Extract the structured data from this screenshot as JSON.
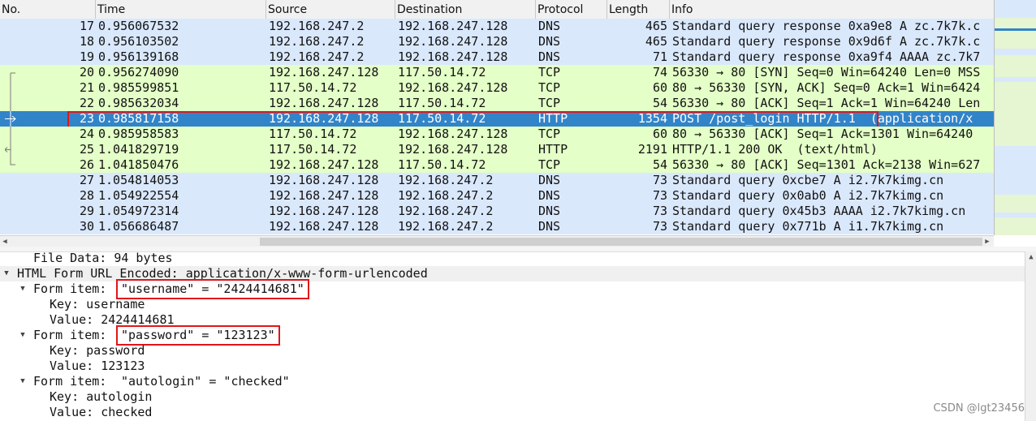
{
  "columns": [
    "No.",
    "Time",
    "Source",
    "Destination",
    "Protocol",
    "Length",
    "Info"
  ],
  "packets": [
    {
      "no": "17",
      "time": "0.956067532",
      "src": "192.168.247.2",
      "dst": "192.168.247.128",
      "proto": "DNS",
      "len": "465",
      "info": "Standard query response 0xa9e8 A zc.7k7k.c"
    },
    {
      "no": "18",
      "time": "0.956103502",
      "src": "192.168.247.2",
      "dst": "192.168.247.128",
      "proto": "DNS",
      "len": "465",
      "info": "Standard query response 0x9d6f A zc.7k7k.c"
    },
    {
      "no": "19",
      "time": "0.956139168",
      "src": "192.168.247.2",
      "dst": "192.168.247.128",
      "proto": "DNS",
      "len": "71",
      "info": "Standard query response 0xa9f4 AAAA zc.7k7"
    },
    {
      "no": "20",
      "time": "0.956274090",
      "src": "192.168.247.128",
      "dst": "117.50.14.72",
      "proto": "TCP",
      "len": "74",
      "info": "56330 → 80 [SYN] Seq=0 Win=64240 Len=0 MSS"
    },
    {
      "no": "21",
      "time": "0.985599851",
      "src": "117.50.14.72",
      "dst": "192.168.247.128",
      "proto": "TCP",
      "len": "60",
      "info": "80 → 56330 [SYN, ACK] Seq=0 Ack=1 Win=6424"
    },
    {
      "no": "22",
      "time": "0.985632034",
      "src": "192.168.247.128",
      "dst": "117.50.14.72",
      "proto": "TCP",
      "len": "54",
      "info": "56330 → 80 [ACK] Seq=1 Ack=1 Win=64240 Len"
    },
    {
      "no": "23",
      "time": "0.985817158",
      "src": "192.168.247.128",
      "dst": "117.50.14.72",
      "proto": "HTTP",
      "len": "1354",
      "info": "POST /post_login HTTP/1.1  (application/x"
    },
    {
      "no": "24",
      "time": "0.985958583",
      "src": "117.50.14.72",
      "dst": "192.168.247.128",
      "proto": "TCP",
      "len": "60",
      "info": "80 → 56330 [ACK] Seq=1 Ack=1301 Win=64240"
    },
    {
      "no": "25",
      "time": "1.041829719",
      "src": "117.50.14.72",
      "dst": "192.168.247.128",
      "proto": "HTTP",
      "len": "2191",
      "info": "HTTP/1.1 200 OK  (text/html)"
    },
    {
      "no": "26",
      "time": "1.041850476",
      "src": "192.168.247.128",
      "dst": "117.50.14.72",
      "proto": "TCP",
      "len": "54",
      "info": "56330 → 80 [ACK] Seq=1301 Ack=2138 Win=627"
    },
    {
      "no": "27",
      "time": "1.054814053",
      "src": "192.168.247.128",
      "dst": "192.168.247.2",
      "proto": "DNS",
      "len": "73",
      "info": "Standard query 0xcbe7 A i2.7k7kimg.cn"
    },
    {
      "no": "28",
      "time": "1.054922554",
      "src": "192.168.247.128",
      "dst": "192.168.247.2",
      "proto": "DNS",
      "len": "73",
      "info": "Standard query 0x0ab0 A i2.7k7kimg.cn"
    },
    {
      "no": "29",
      "time": "1.054972314",
      "src": "192.168.247.128",
      "dst": "192.168.247.2",
      "proto": "DNS",
      "len": "73",
      "info": "Standard query 0x45b3 AAAA i2.7k7kimg.cn"
    },
    {
      "no": "30",
      "time": "1.056686487",
      "src": "192.168.247.128",
      "dst": "192.168.247.2",
      "proto": "DNS",
      "len": "73",
      "info": "Standard query 0x771b A i1.7k7kimg.cn"
    }
  ],
  "details": {
    "file_data": "File Data: 94 bytes",
    "form_header": "HTML Form URL Encoded: application/x-www-form-urlencoded",
    "form_item_label": "Form item: ",
    "items": [
      {
        "summary": "\"username\" = \"2424414681\"",
        "key": "Key: username",
        "value": "Value: 2424414681"
      },
      {
        "summary": "\"password\" = \"123123\"",
        "key": "Key: password",
        "value": "Value: 123123"
      },
      {
        "summary": "\"autologin\" = \"checked\"",
        "key": "Key: autologin",
        "value": "Value: checked"
      }
    ]
  },
  "watermark": "CSDN @lgt23456",
  "colors": {
    "dns_row": "#dae8fc",
    "tcp_row": "#e4ffc7",
    "selected_row": "#3284c9",
    "highlight_box": "#e0161a"
  }
}
